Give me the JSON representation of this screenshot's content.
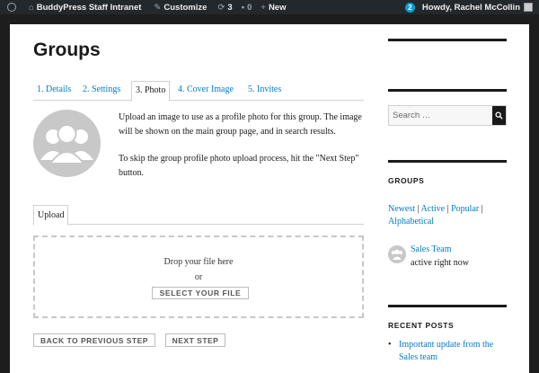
{
  "adminbar": {
    "site_name": "BuddyPress Staff Intranet",
    "customize": "Customize",
    "updates_count": "3",
    "comments_count": "0",
    "new_label": "New",
    "notifications_count": "2",
    "greeting": "Howdy, Rachel McCollin"
  },
  "main": {
    "title": "Groups",
    "tabs": [
      {
        "label": "1. Details"
      },
      {
        "label": "2. Settings"
      },
      {
        "label": "3. Photo"
      },
      {
        "label": "4. Cover Image"
      },
      {
        "label": "5. Invites"
      }
    ],
    "intro_p1": "Upload an image to use as a profile photo for this group. The image will be shown on the main group page, and in search results.",
    "intro_p2": "To skip the group profile photo upload process, hit the \"Next Step\" button.",
    "upload_tab": "Upload",
    "drop_text": "Drop your file here",
    "drop_or": "or",
    "select_button": "SELECT YOUR FILE",
    "prev_button": "BACK TO PREVIOUS STEP",
    "next_button": "NEXT STEP"
  },
  "sidebar": {
    "search_placeholder": "Search …",
    "groups_title": "GROUPS",
    "filters": [
      "Newest",
      "Active",
      "Popular",
      "Alphabetical"
    ],
    "group_name": "Sales Team",
    "group_status": "active right now",
    "recent_title": "RECENT POSTS",
    "recent_posts": [
      "Important update from the Sales team"
    ]
  },
  "colors": {
    "link": "#007acc",
    "adminbar_bg": "#23282d",
    "badge": "#00a0d2"
  }
}
